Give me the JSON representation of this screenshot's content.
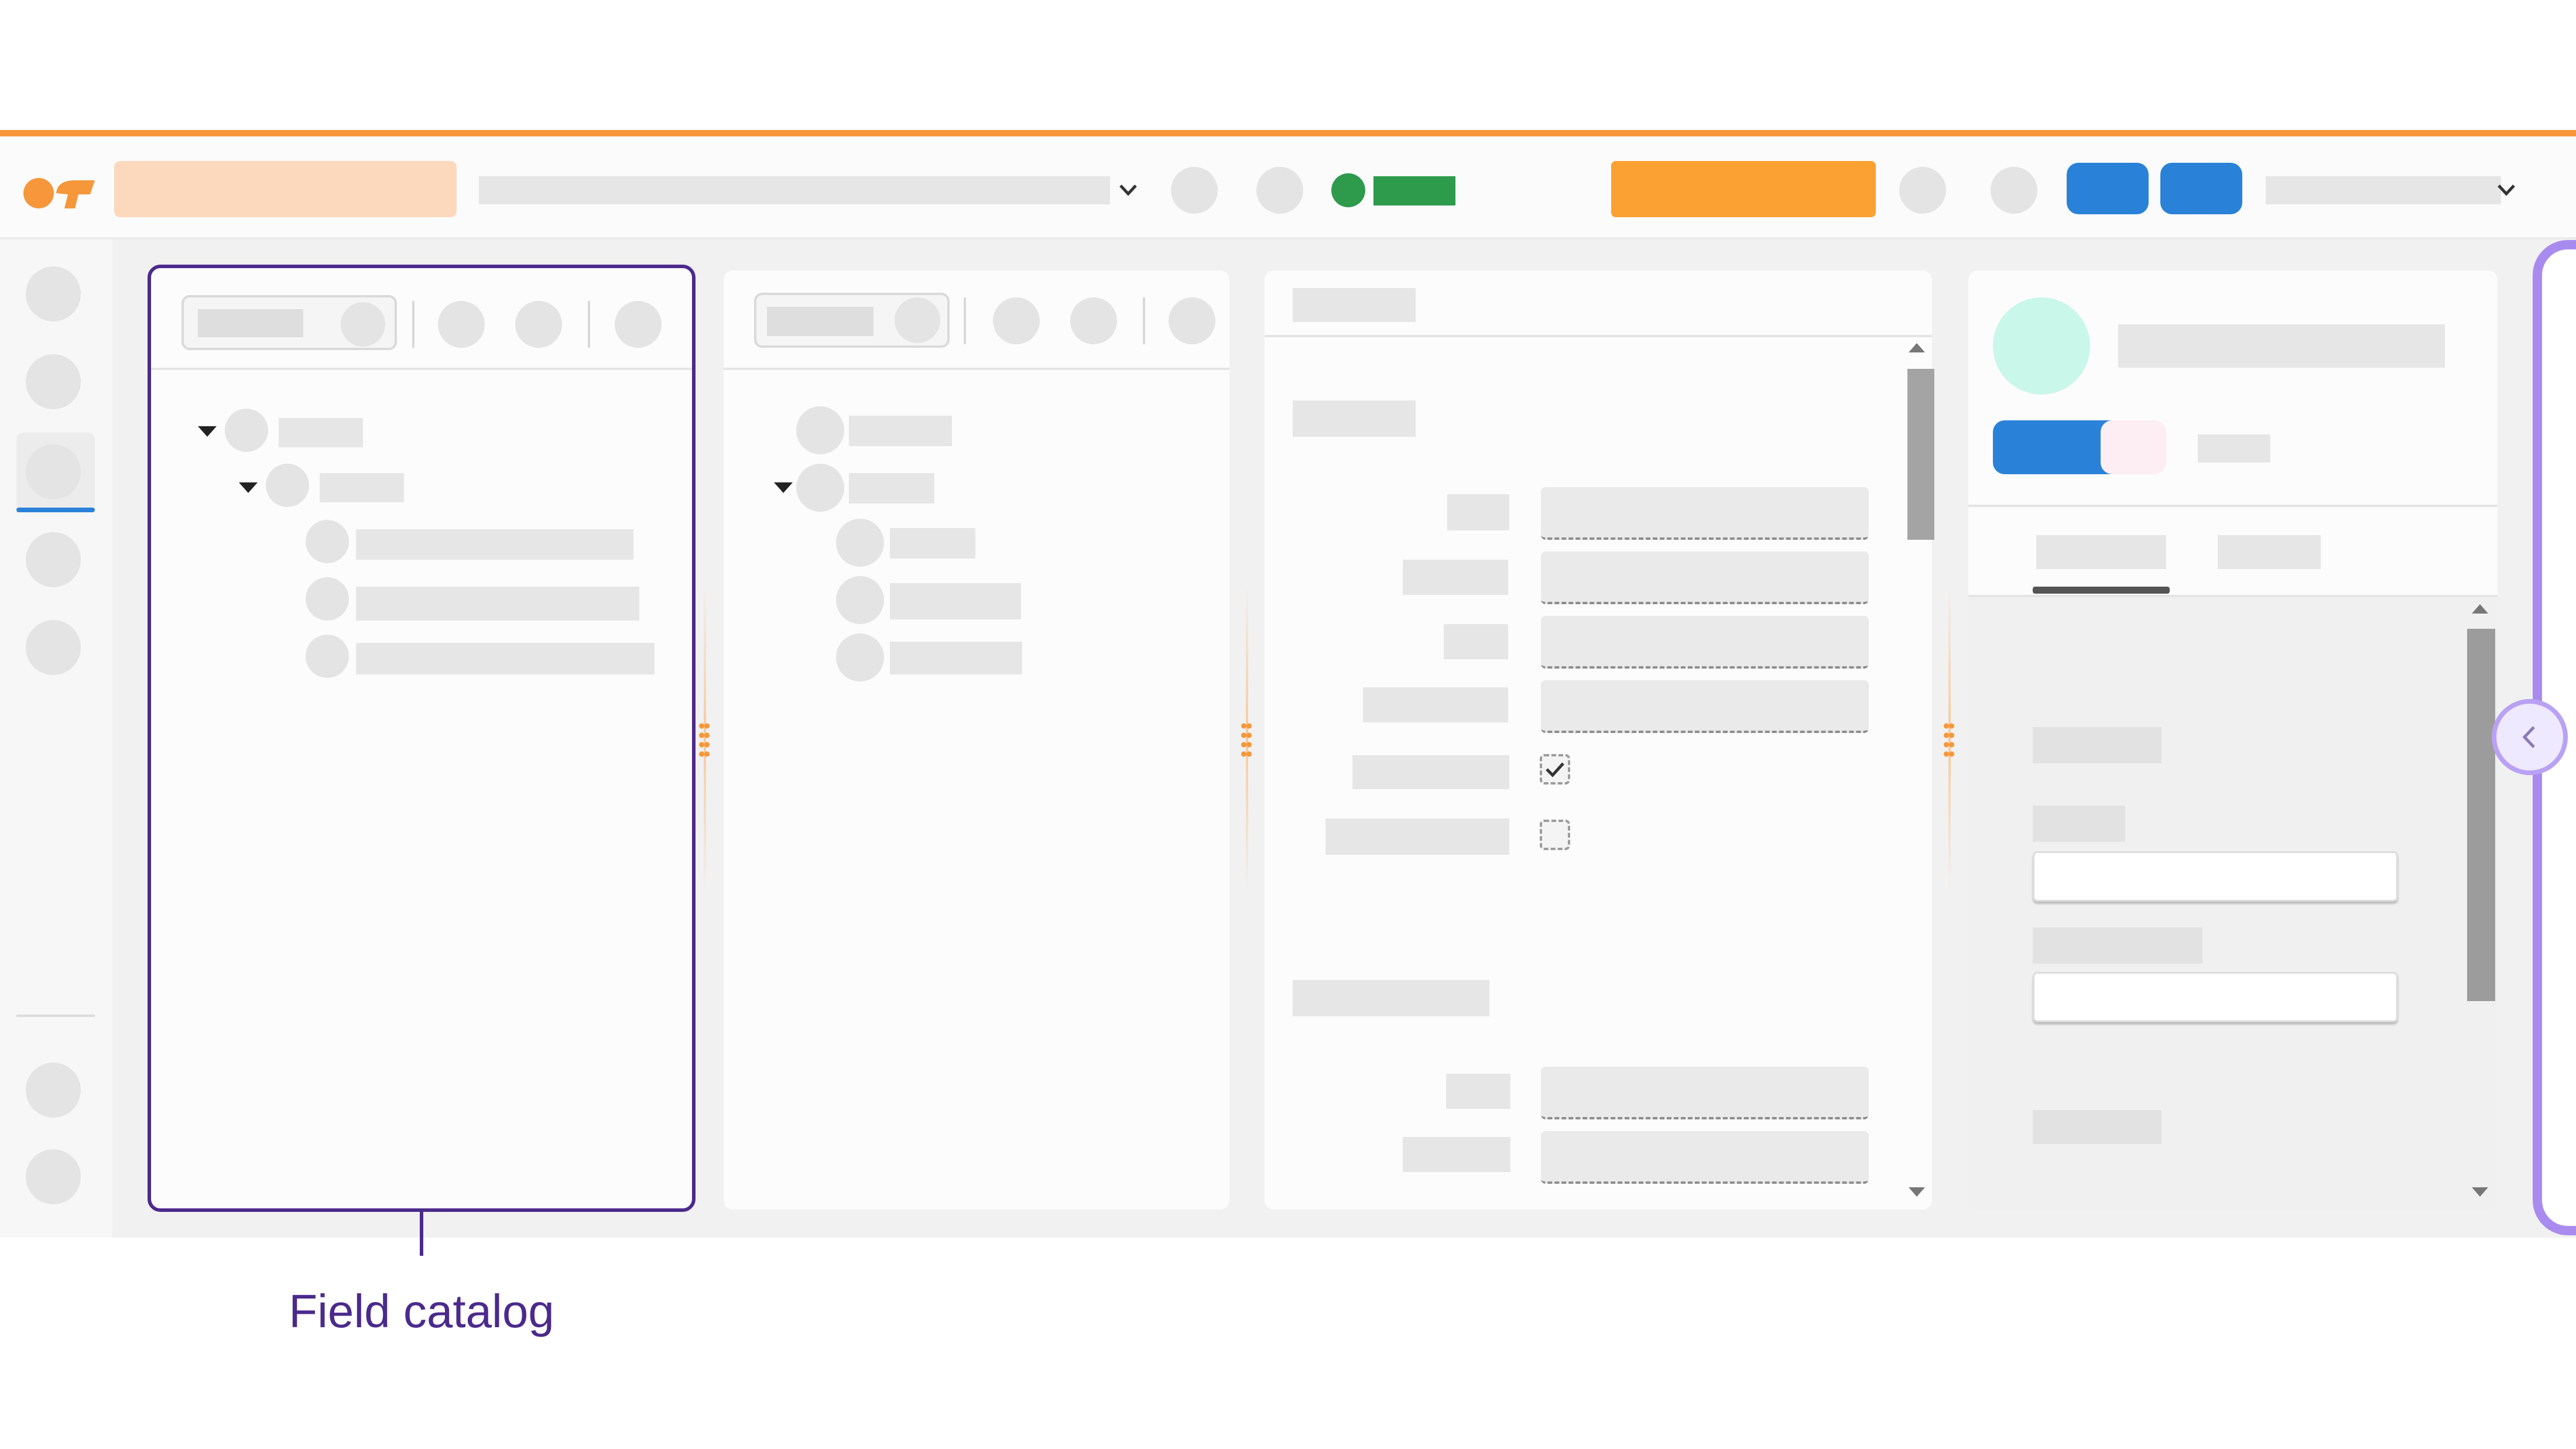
{
  "callout": {
    "label": "Field catalog"
  },
  "colors": {
    "accent": "#f5973a",
    "highlight": "#4b2a8c",
    "purple_edge": "#a98bf0",
    "status_green": "#2e9a4c",
    "action_blue": "#2a82d8",
    "avatar": "#c9f7e9"
  },
  "icons": {
    "logo": "logo-icon",
    "dropdown": "chevron-down-icon",
    "tree_expand": "caret-down-icon",
    "checkbox_checked": "checkmark-icon",
    "collapse": "chevron-left-icon",
    "drag": "drag-handle-icon"
  },
  "checkboxes": {
    "first_checked": true,
    "second_checked": false
  }
}
